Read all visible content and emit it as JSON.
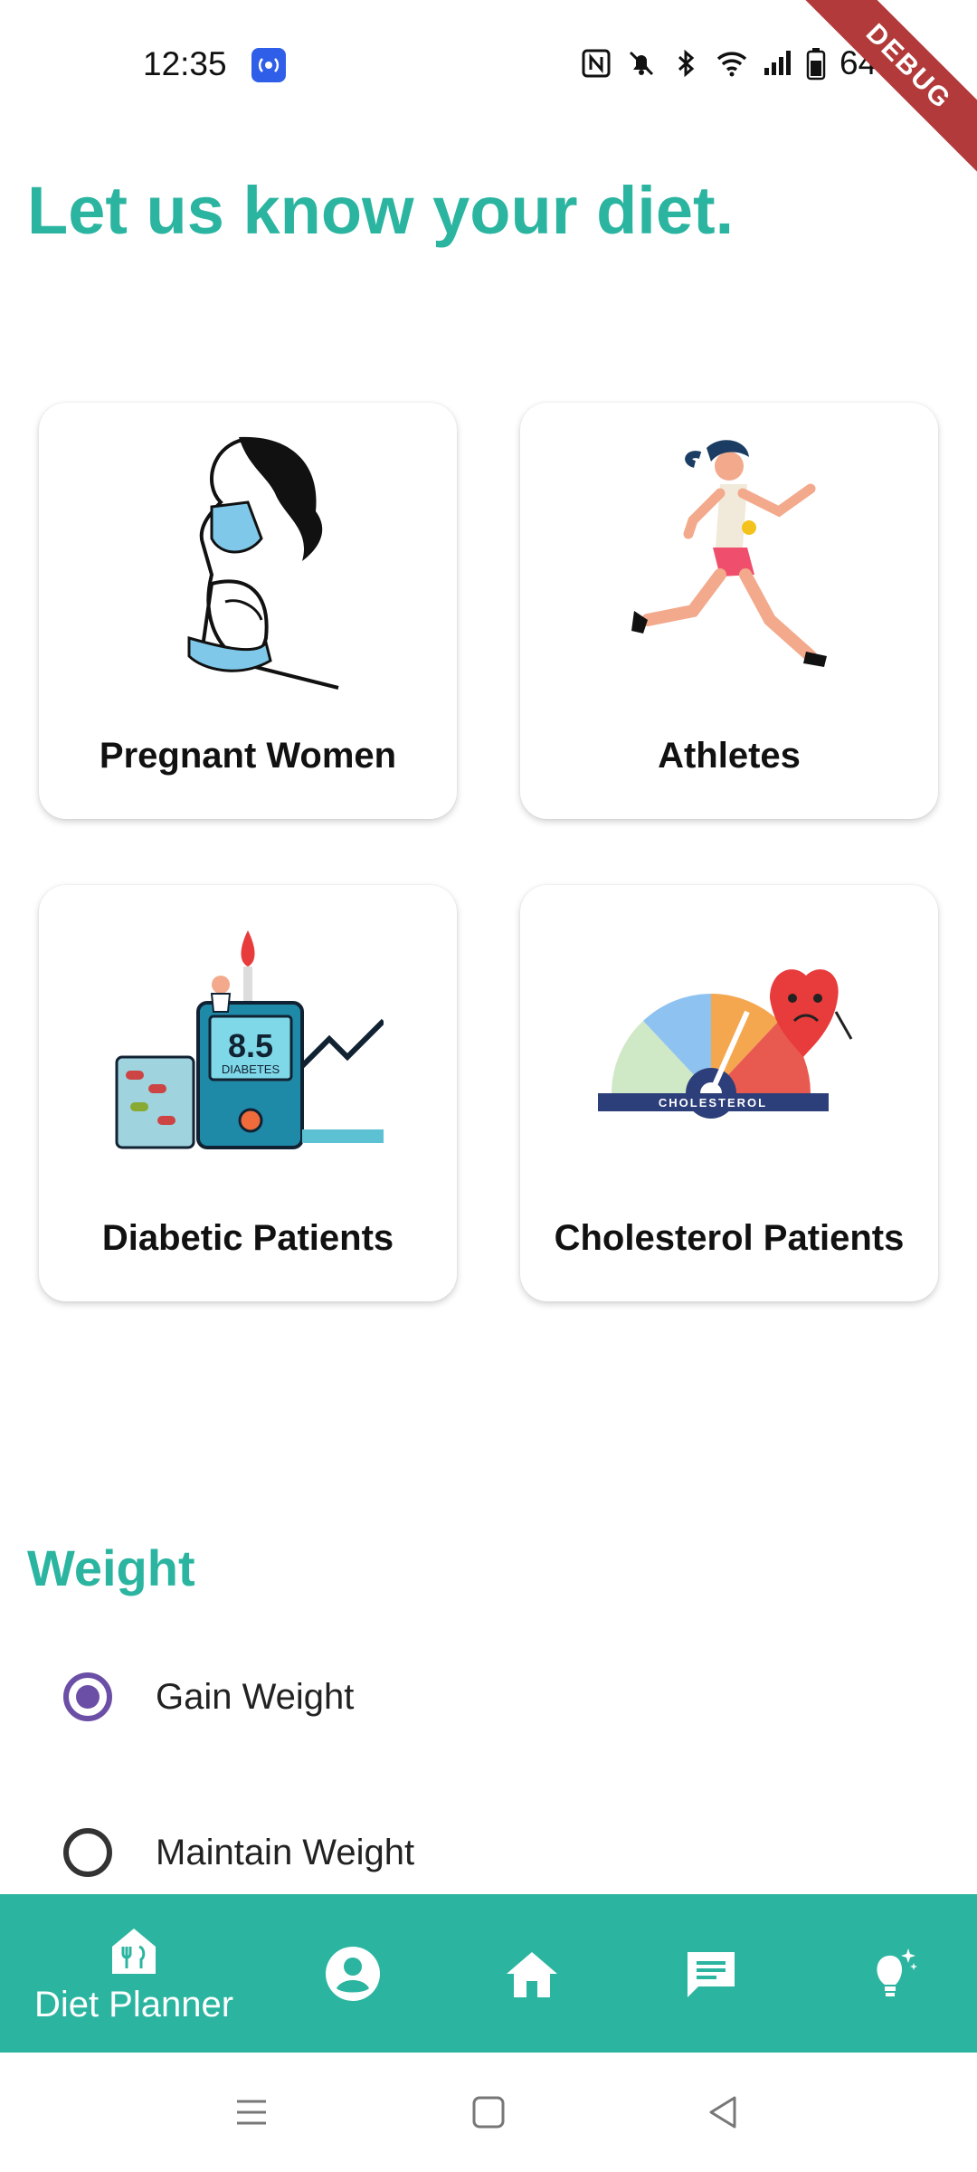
{
  "status_bar": {
    "time": "12:35",
    "battery": "64%",
    "icons": [
      "nfc-icon",
      "mute-icon",
      "bluetooth-icon",
      "wifi-icon",
      "signal-icon",
      "battery-icon"
    ]
  },
  "debug_banner": "DEBUG",
  "page_title": "Let us know your diet.",
  "cards": [
    {
      "label": "Pregnant Women",
      "image": "pregnant-woman-illustration"
    },
    {
      "label": "Athletes",
      "image": "running-athlete-illustration"
    },
    {
      "label": "Diabetic Patients",
      "image": "glucose-meter-illustration",
      "reading": "8.5",
      "reading_caption": "DIABETES"
    },
    {
      "label": "Cholesterol Patients",
      "image": "cholesterol-gauge-illustration",
      "gauge_caption": "CHOLESTEROL"
    }
  ],
  "weight_section": {
    "title": "Weight",
    "options": [
      {
        "label": "Gain Weight",
        "selected": true
      },
      {
        "label": "Maintain Weight",
        "selected": false
      }
    ]
  },
  "bottom_nav": {
    "items": [
      {
        "icon": "restaurant-home-icon",
        "label": "Diet Planner"
      },
      {
        "icon": "profile-icon"
      },
      {
        "icon": "home-icon"
      },
      {
        "icon": "chat-icon"
      },
      {
        "icon": "lightbulb-icon"
      }
    ]
  },
  "colors": {
    "accent": "#2bb5a0",
    "radio_selected": "#6b4fa6",
    "debug": "#b23a3a"
  }
}
